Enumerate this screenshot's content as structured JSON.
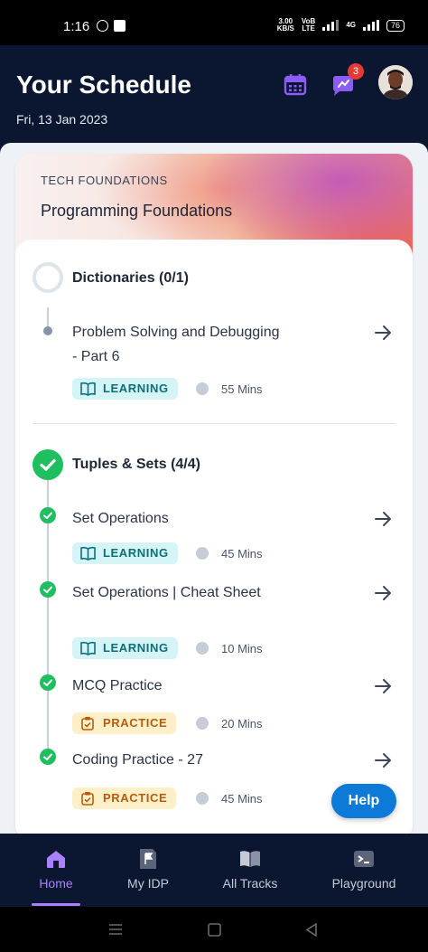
{
  "status_bar": {
    "time": "1:16",
    "net_speed_top": "3.00",
    "net_speed_unit": "KB/S",
    "volte_top": "VoB",
    "volte_bottom": "LTE",
    "network": "4G",
    "battery": "76"
  },
  "header": {
    "title": "Your Schedule",
    "date": "Fri, 13 Jan 2023",
    "notification_count": "3"
  },
  "card": {
    "track": "TECH FOUNDATIONS",
    "course": "Programming Foundations",
    "sections": [
      {
        "title": "Dictionaries (0/1)",
        "status": "pending",
        "items": [
          {
            "title": "Problem Solving and Debugging - Part 6",
            "tag": "LEARNING",
            "duration": "55 Mins",
            "done": false
          }
        ]
      },
      {
        "title": "Tuples & Sets (4/4)",
        "status": "done",
        "items": [
          {
            "title": "Set Operations",
            "tag": "LEARNING",
            "duration": "45 Mins",
            "done": true
          },
          {
            "title": "Set Operations | Cheat Sheet",
            "tag": "LEARNING",
            "duration": "10 Mins",
            "done": true
          },
          {
            "title": "MCQ Practice",
            "tag": "PRACTICE",
            "duration": "20 Mins",
            "done": true
          },
          {
            "title": "Coding Practice - 27",
            "tag": "PRACTICE",
            "duration": "45 Mins",
            "done": true
          }
        ]
      }
    ]
  },
  "help_label": "Help",
  "bottom_nav": {
    "items": [
      {
        "label": "Home",
        "icon": "home-icon",
        "active": true
      },
      {
        "label": "My IDP",
        "icon": "flag-document-icon",
        "active": false
      },
      {
        "label": "All Tracks",
        "icon": "book-icon",
        "active": false
      },
      {
        "label": "Playground",
        "icon": "terminal-icon",
        "active": false
      }
    ]
  },
  "colors": {
    "header_bg": "#0b1730",
    "accent_purple": "#a981ff",
    "done_green": "#1fbf5f",
    "help_blue": "#0e7ad8",
    "learning_bg": "#d5f4f5",
    "practice_bg": "#fdf0c8"
  }
}
